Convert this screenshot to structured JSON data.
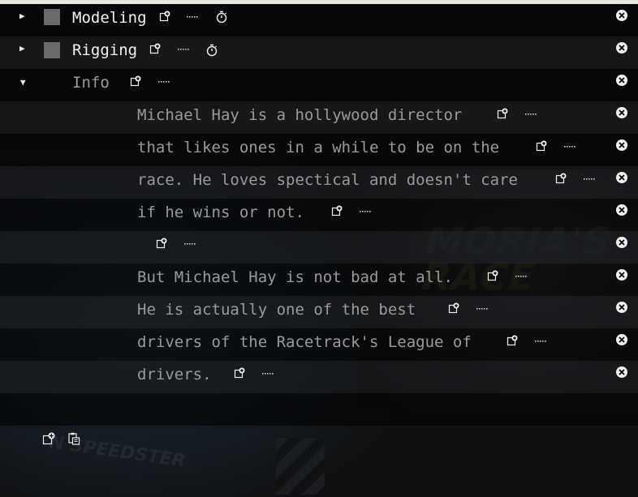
{
  "outline": {
    "rows": [
      {
        "label": "Modeling",
        "kind": "section",
        "expanded": false
      },
      {
        "label": "Rigging",
        "kind": "section",
        "expanded": false
      },
      {
        "label": "Info",
        "kind": "folder",
        "expanded": true
      },
      {
        "label": "Michael Hay is a hollywood director"
      },
      {
        "label": "that likes ones in a while to be on the"
      },
      {
        "label": "race. He loves spectical and doesn't care"
      },
      {
        "label": "if he wins or not."
      },
      {
        "label": ""
      },
      {
        "label": "But Michael Hay is not bad at all."
      },
      {
        "label": "He is actually one of the best"
      },
      {
        "label": "drivers of the Racetrack's League of"
      },
      {
        "label": "drivers."
      }
    ]
  },
  "icons": {
    "add": "add-item-icon",
    "more": "more-icon",
    "timer": "timer-icon",
    "close": "close-icon",
    "paste": "paste-icon",
    "expand": "expand-arrow-icon",
    "collapse": "collapse-arrow-icon"
  },
  "colors": {
    "text_bright": "#f2f2f2",
    "text_dim": "#9a9a9a",
    "row_dark": "#000000",
    "row_alt": "#181a1c",
    "square": "#6a6a6a"
  }
}
